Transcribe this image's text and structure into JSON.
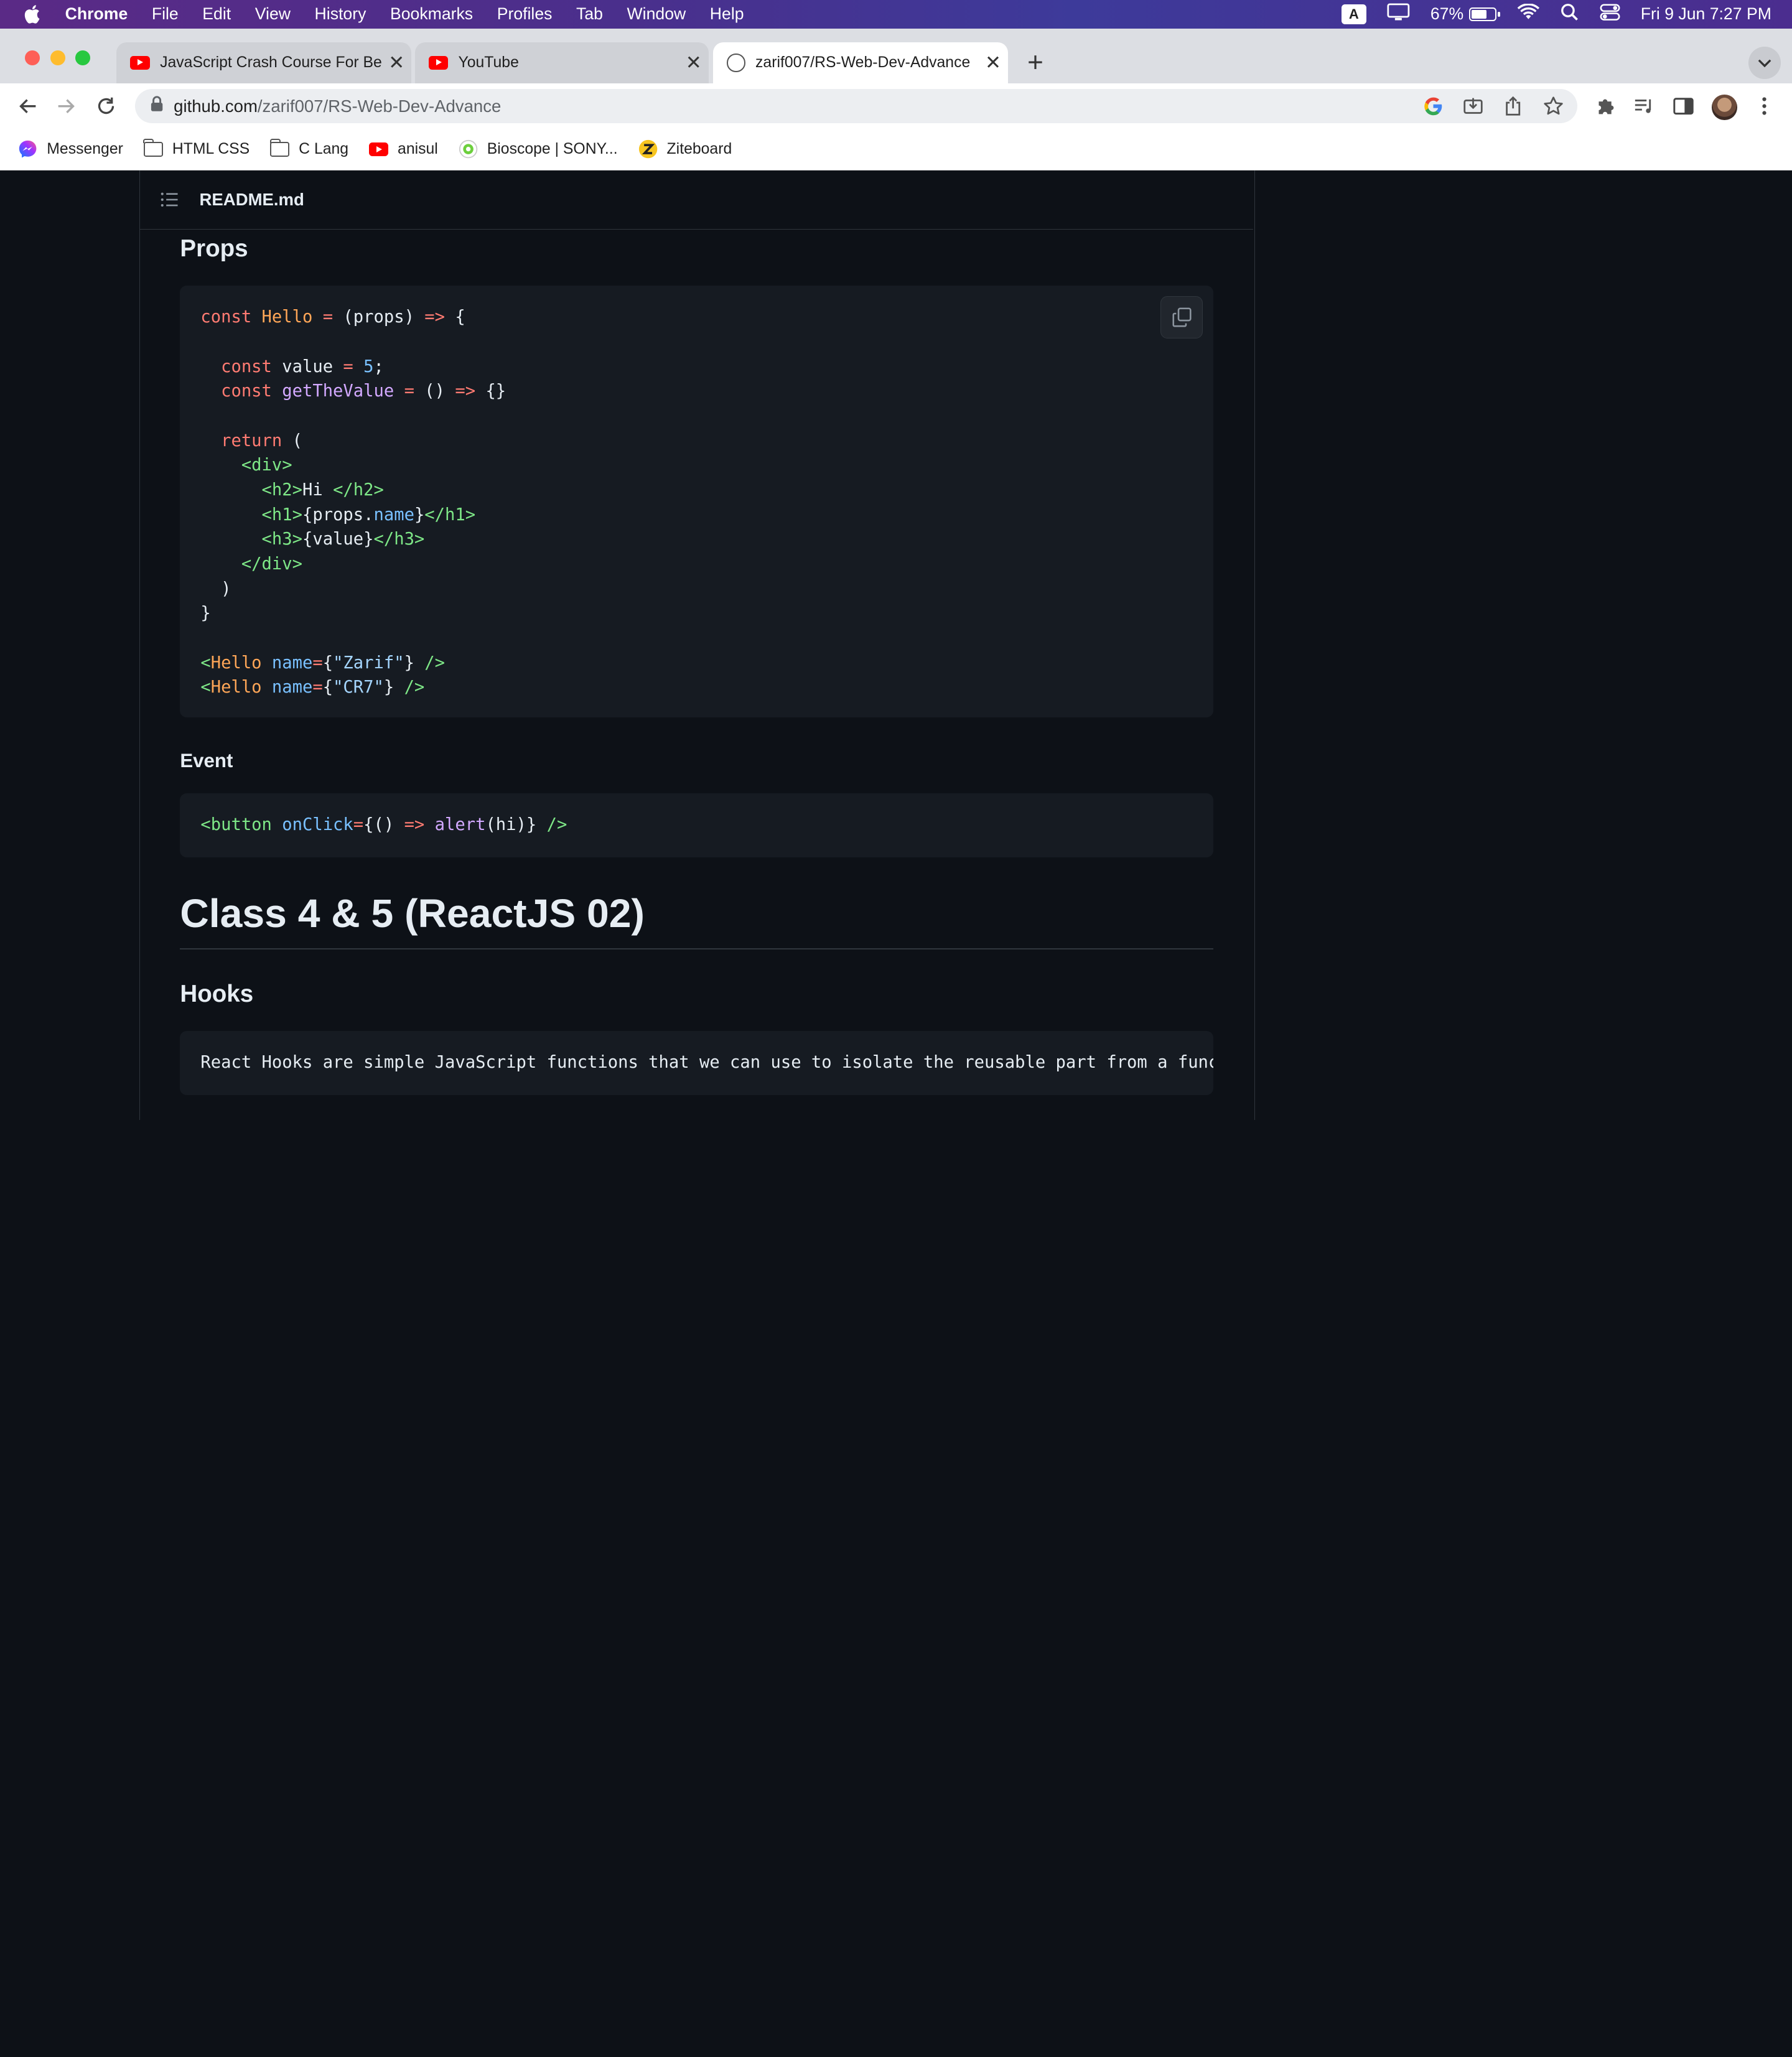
{
  "menubar": {
    "app": "Chrome",
    "items": [
      "File",
      "Edit",
      "View",
      "History",
      "Bookmarks",
      "Profiles",
      "Tab",
      "Window",
      "Help"
    ],
    "input_source": "A",
    "battery": "67%",
    "datetime": "Fri 9 Jun  7:27 PM"
  },
  "tabs": [
    {
      "title": "JavaScript Crash Course For Beginners",
      "icon": "youtube-icon"
    },
    {
      "title": "YouTube",
      "icon": "youtube-icon"
    },
    {
      "title": "zarif007/RS-Web-Dev-Advance",
      "icon": "github-icon"
    }
  ],
  "omnibox": {
    "host": "github.com",
    "path": "/zarif007/RS-Web-Dev-Advance"
  },
  "bookmarks": [
    {
      "label": "Messenger",
      "icon": "messenger-icon"
    },
    {
      "label": "HTML CSS",
      "icon": "folder-icon"
    },
    {
      "label": "C Lang",
      "icon": "folder-icon"
    },
    {
      "label": "anisul",
      "icon": "youtube-icon"
    },
    {
      "label": "Bioscope | SONY...",
      "icon": "bioscope-icon"
    },
    {
      "label": "Ziteboard",
      "icon": "ziteboard-icon"
    }
  ],
  "readme": {
    "filename": "README.md",
    "props_heading": "Props",
    "event_heading": "Event",
    "class_heading": "Class 4 & 5 (ReactJS 02)",
    "hooks_heading": "Hooks",
    "hooks_text": "React Hooks are simple JavaScript functions that we can use to isolate the reusable part from a functional component."
  },
  "colors": {
    "page_bg": "#0d1117",
    "code_bg": "#161b22",
    "border": "#30363d"
  }
}
